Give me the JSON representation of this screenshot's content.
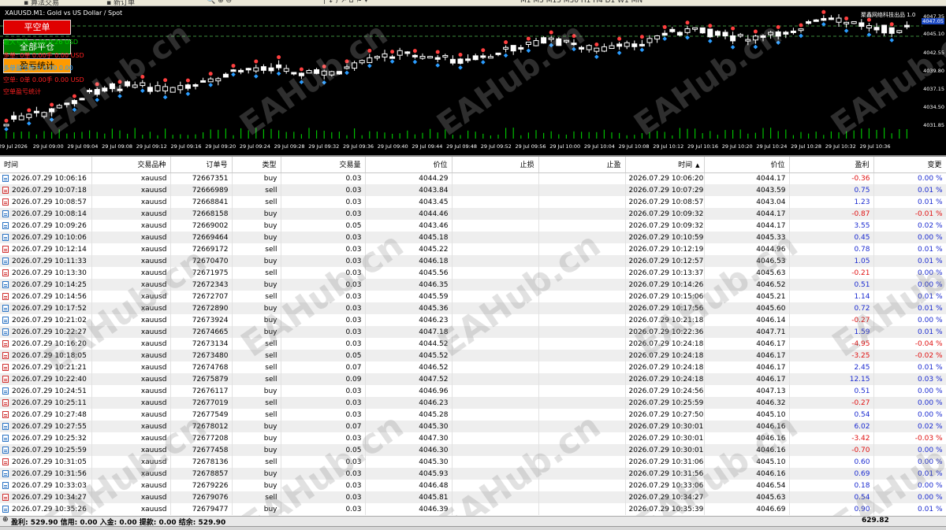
{
  "chart": {
    "symbol_title": "XAUUSD.M1: Gold vs US Dollar / Spot",
    "indicator_title": "聚鑫网络科技出品 1.0",
    "current_price": "4047.05",
    "buttons": {
      "close_short": "平空单",
      "close_all": "全部平仓",
      "hedge_close": "盈亏统计"
    },
    "info_lines": [
      {
        "text": "最大亏损: 0.00  0.26 USD",
        "color": "#00d000"
      },
      {
        "text": "多单: 0单  0.00手  0.00 USD",
        "color": "#ff2020"
      },
      {
        "text": "多单盈亏统计  0.00  0.00",
        "color": "#2aa0ff"
      },
      {
        "text": "空单: 0单  0.00手  0.00 USD",
        "color": "#ff2020"
      },
      {
        "text": "空单盈亏统计",
        "color": "#ff2020"
      }
    ],
    "price_labels": [
      "4047.35",
      "4045.10",
      "4042.55",
      "4039.80",
      "4037.15",
      "4034.50",
      "4031.85"
    ],
    "time_labels": [
      "29 Jul 2026",
      "29 Jul 09:00",
      "29 Jul 09:04",
      "29 Jul 09:08",
      "29 Jul 09:12",
      "29 Jul 09:16",
      "29 Jul 09:20",
      "29 Jul 09:24",
      "29 Jul 09:28",
      "29 Jul 09:32",
      "29 Jul 09:36",
      "29 Jul 09:40",
      "29 Jul 09:44",
      "29 Jul 09:48",
      "29 Jul 09:52",
      "29 Jul 09:56",
      "29 Jul 10:00",
      "29 Jul 10:04",
      "29 Jul 10:08",
      "29 Jul 10:12",
      "29 Jul 10:16",
      "29 Jul 10:20",
      "29 Jul 10:24",
      "29 Jul 10:28",
      "29 Jul 10:32",
      "29 Jul 10:36"
    ],
    "watermark": "EAHub.cn",
    "colors": {
      "background": "#000000",
      "bull_candle": "#ffffff",
      "bear_candle": "#000000",
      "volume": "#00c000",
      "grid": "#404040"
    }
  },
  "table": {
    "columns": [
      "时间",
      "交易品种",
      "订单号",
      "类型",
      "交易量",
      "价位",
      "止损",
      "止盈",
      "时间",
      "价位",
      "盈利",
      "变更"
    ],
    "sorted_column": 8,
    "rows": [
      [
        "2026.07.29 10:06:16",
        "xauusd",
        "72667351",
        "buy",
        "0.03",
        "4044.29",
        "",
        "",
        "2026.07.29 10:06:20",
        "4044.17",
        "-0.36",
        "0.00 %"
      ],
      [
        "2026.07.29 10:07:18",
        "xauusd",
        "72666989",
        "sell",
        "0.03",
        "4043.84",
        "",
        "",
        "2026.07.29 10:07:29",
        "4043.59",
        "0.75",
        "0.01 %"
      ],
      [
        "2026.07.29 10:08:57",
        "xauusd",
        "72668841",
        "sell",
        "0.03",
        "4043.45",
        "",
        "",
        "2026.07.29 10:08:57",
        "4043.04",
        "1.23",
        "0.01 %"
      ],
      [
        "2026.07.29 10:08:14",
        "xauusd",
        "72668158",
        "buy",
        "0.03",
        "4044.46",
        "",
        "",
        "2026.07.29 10:09:32",
        "4044.17",
        "-0.87",
        "-0.01 %"
      ],
      [
        "2026.07.29 10:09:26",
        "xauusd",
        "72669002",
        "buy",
        "0.05",
        "4043.46",
        "",
        "",
        "2026.07.29 10:09:32",
        "4044.17",
        "3.55",
        "0.02 %"
      ],
      [
        "2026.07.29 10:10:06",
        "xauusd",
        "72669464",
        "buy",
        "0.03",
        "4045.18",
        "",
        "",
        "2026.07.29 10:10:59",
        "4045.33",
        "0.45",
        "0.00 %"
      ],
      [
        "2026.07.29 10:12:14",
        "xauusd",
        "72669172",
        "sell",
        "0.03",
        "4045.22",
        "",
        "",
        "2026.07.29 10:12:19",
        "4044.96",
        "0.78",
        "0.01 %"
      ],
      [
        "2026.07.29 10:11:33",
        "xauusd",
        "72670470",
        "buy",
        "0.03",
        "4046.18",
        "",
        "",
        "2026.07.29 10:12:57",
        "4046.53",
        "1.05",
        "0.01 %"
      ],
      [
        "2026.07.29 10:13:30",
        "xauusd",
        "72671975",
        "sell",
        "0.03",
        "4045.56",
        "",
        "",
        "2026.07.29 10:13:37",
        "4045.63",
        "-0.21",
        "0.00 %"
      ],
      [
        "2026.07.29 10:14:25",
        "xauusd",
        "72672343",
        "buy",
        "0.03",
        "4046.35",
        "",
        "",
        "2026.07.29 10:14:26",
        "4046.52",
        "0.51",
        "0.00 %"
      ],
      [
        "2026.07.29 10:14:56",
        "xauusd",
        "72672707",
        "sell",
        "0.03",
        "4045.59",
        "",
        "",
        "2026.07.29 10:15:06",
        "4045.21",
        "1.14",
        "0.01 %"
      ],
      [
        "2026.07.29 10:17:52",
        "xauusd",
        "72672890",
        "buy",
        "0.03",
        "4045.36",
        "",
        "",
        "2026.07.29 10:17:56",
        "4045.60",
        "0.72",
        "0.01 %"
      ],
      [
        "2026.07.29 10:21:02",
        "xauusd",
        "72673924",
        "buy",
        "0.03",
        "4046.23",
        "",
        "",
        "2026.07.29 10:21:18",
        "4046.14",
        "-0.27",
        "0.00 %"
      ],
      [
        "2026.07.29 10:22:27",
        "xauusd",
        "72674665",
        "buy",
        "0.03",
        "4047.18",
        "",
        "",
        "2026.07.29 10:22:36",
        "4047.71",
        "1.59",
        "0.01 %"
      ],
      [
        "2026.07.29 10:16:20",
        "xauusd",
        "72673134",
        "sell",
        "0.03",
        "4044.52",
        "",
        "",
        "2026.07.29 10:24:18",
        "4046.17",
        "-4.95",
        "-0.04 %"
      ],
      [
        "2026.07.29 10:18:05",
        "xauusd",
        "72673480",
        "sell",
        "0.05",
        "4045.52",
        "",
        "",
        "2026.07.29 10:24:18",
        "4046.17",
        "-3.25",
        "-0.02 %"
      ],
      [
        "2026.07.29 10:21:21",
        "xauusd",
        "72674768",
        "sell",
        "0.07",
        "4046.52",
        "",
        "",
        "2026.07.29 10:24:18",
        "4046.17",
        "2.45",
        "0.01 %"
      ],
      [
        "2026.07.29 10:22:40",
        "xauusd",
        "72675879",
        "sell",
        "0.09",
        "4047.52",
        "",
        "",
        "2026.07.29 10:24:18",
        "4046.17",
        "12.15",
        "0.03 %"
      ],
      [
        "2026.07.29 10:24:51",
        "xauusd",
        "72676117",
        "buy",
        "0.03",
        "4046.96",
        "",
        "",
        "2026.07.29 10:24:56",
        "4047.13",
        "0.51",
        "0.00 %"
      ],
      [
        "2026.07.29 10:25:11",
        "xauusd",
        "72677019",
        "sell",
        "0.03",
        "4046.23",
        "",
        "",
        "2026.07.29 10:25:59",
        "4046.32",
        "-0.27",
        "0.00 %"
      ],
      [
        "2026.07.29 10:27:48",
        "xauusd",
        "72677549",
        "sell",
        "0.03",
        "4045.28",
        "",
        "",
        "2026.07.29 10:27:50",
        "4045.10",
        "0.54",
        "0.00 %"
      ],
      [
        "2026.07.29 10:27:55",
        "xauusd",
        "72678012",
        "buy",
        "0.07",
        "4045.30",
        "",
        "",
        "2026.07.29 10:30:01",
        "4046.16",
        "6.02",
        "0.02 %"
      ],
      [
        "2026.07.29 10:25:32",
        "xauusd",
        "72677208",
        "buy",
        "0.03",
        "4047.30",
        "",
        "",
        "2026.07.29 10:30:01",
        "4046.16",
        "-3.42",
        "-0.03 %"
      ],
      [
        "2026.07.29 10:25:59",
        "xauusd",
        "72677458",
        "buy",
        "0.05",
        "4046.30",
        "",
        "",
        "2026.07.29 10:30:01",
        "4046.16",
        "-0.70",
        "0.00 %"
      ],
      [
        "2026.07.29 10:31:05",
        "xauusd",
        "72678136",
        "sell",
        "0.03",
        "4045.30",
        "",
        "",
        "2026.07.29 10:31:06",
        "4045.10",
        "0.60",
        "0.00 %"
      ],
      [
        "2026.07.29 10:31:56",
        "xauusd",
        "72678857",
        "buy",
        "0.03",
        "4045.93",
        "",
        "",
        "2026.07.29 10:31:56",
        "4046.16",
        "0.69",
        "0.01 %"
      ],
      [
        "2026.07.29 10:33:03",
        "xauusd",
        "72679226",
        "buy",
        "0.03",
        "4046.48",
        "",
        "",
        "2026.07.29 10:33:06",
        "4046.54",
        "0.18",
        "0.00 %"
      ],
      [
        "2026.07.29 10:34:27",
        "xauusd",
        "72679076",
        "sell",
        "0.03",
        "4045.81",
        "",
        "",
        "2026.07.29 10:34:27",
        "4045.63",
        "0.54",
        "0.00 %"
      ],
      [
        "2026.07.29 10:35:26",
        "xauusd",
        "72679477",
        "buy",
        "0.03",
        "4046.39",
        "",
        "",
        "2026.07.29 10:35:39",
        "4046.69",
        "0.90",
        "0.01 %"
      ]
    ]
  },
  "status": {
    "summary": "盈利: 529.90  信用: 0.00  入金: 0.00  提款: 0.00  结余: 529.90",
    "total_profit": "629.82"
  },
  "watermark": "EAHub.cn"
}
